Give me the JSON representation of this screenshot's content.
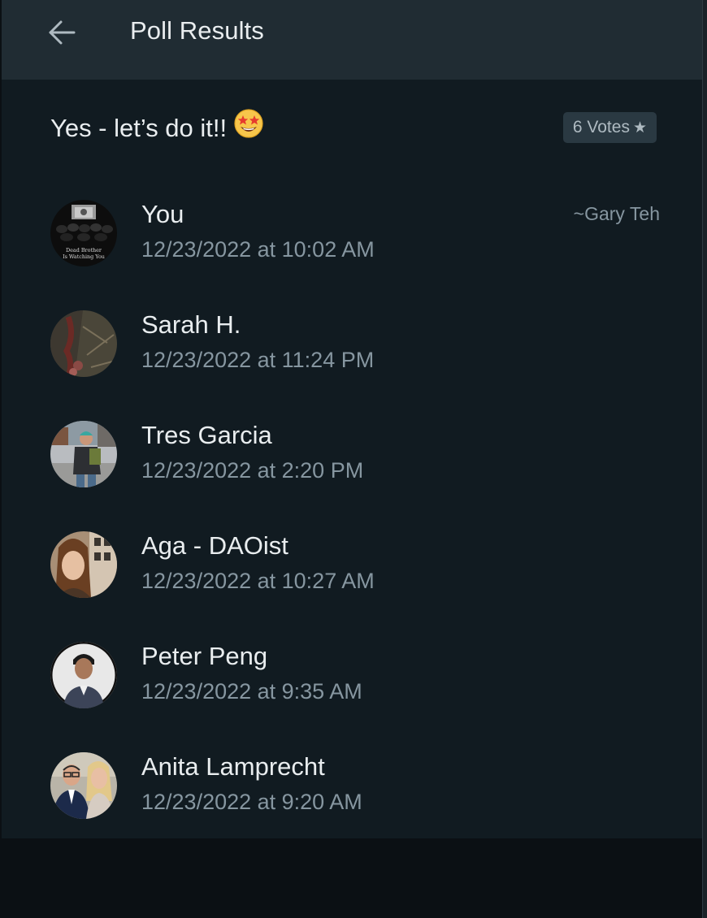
{
  "header": {
    "title": "Poll Results",
    "back_icon": "arrow-left-icon"
  },
  "option": {
    "text": "Yes - let’s do it!!",
    "emoji": "star-struck-emoji",
    "votes_label": "6 Votes",
    "votes_icon": "★"
  },
  "voters": [
    {
      "name": "You",
      "time": "12/23/2022 at 10:02 AM",
      "alias": "~Gary Teh",
      "avatar_text": "Dead Brother Is Watching You"
    },
    {
      "name": "Sarah H.",
      "time": "12/23/2022 at 11:24 PM"
    },
    {
      "name": "Tres Garcia",
      "time": "12/23/2022 at 2:20 PM"
    },
    {
      "name": "Aga - DAOist",
      "time": "12/23/2022 at 10:27 AM"
    },
    {
      "name": "Peter Peng",
      "time": "12/23/2022 at 9:35 AM"
    },
    {
      "name": "Anita Lamprecht",
      "time": "12/23/2022 at 9:20 AM"
    }
  ],
  "colors": {
    "panel": "#111b21",
    "header": "#202c33",
    "text_primary": "#e9edef",
    "text_secondary": "#8696a0",
    "badge_bg": "#2a3942"
  }
}
